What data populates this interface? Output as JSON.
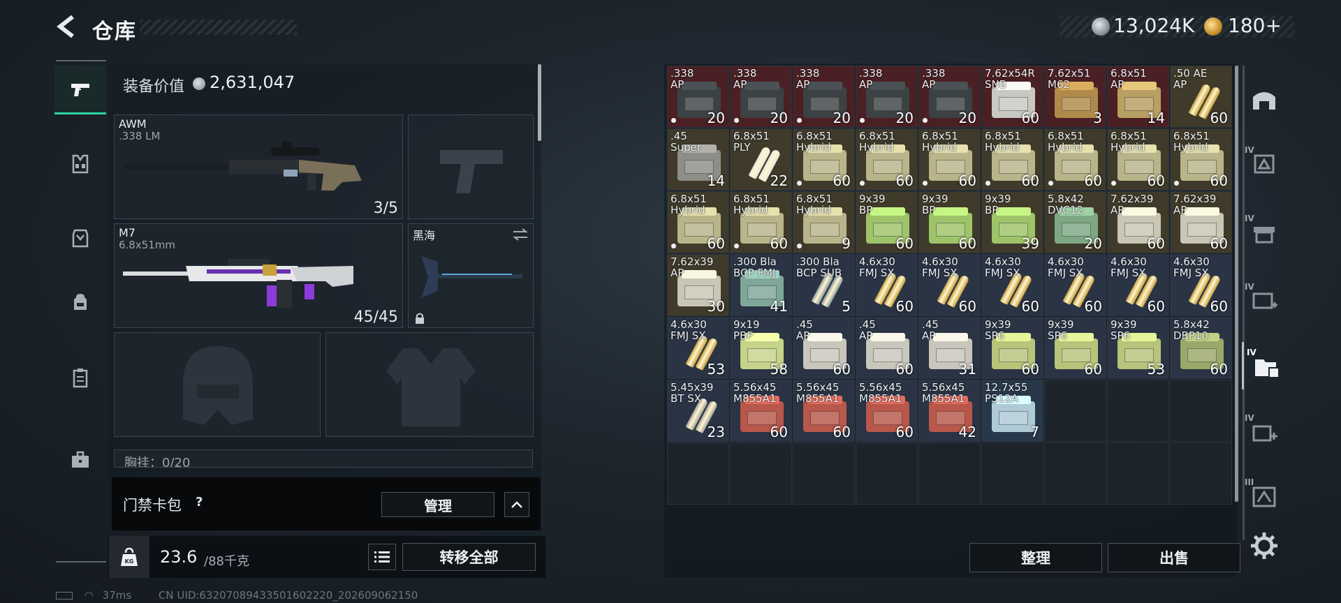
{
  "header": {
    "title": "仓库",
    "currency_silver": "13,024K",
    "currency_gold": "180+"
  },
  "left_nav": {
    "items": [
      {
        "icon": "pistol-icon",
        "active": true
      },
      {
        "icon": "vest-icon"
      },
      {
        "icon": "armor-icon"
      },
      {
        "icon": "backpack-icon"
      },
      {
        "icon": "clipboard-icon"
      },
      {
        "icon": "briefcase-icon"
      }
    ]
  },
  "loadout": {
    "equipment_value_label": "装备价值",
    "equipment_value": "2,631,047",
    "primary": {
      "name": "AWM",
      "caliber": ".338 LM",
      "count": "3/5"
    },
    "secondary": {
      "name": "M7",
      "caliber": "6.8x51mm",
      "count": "45/45"
    },
    "melee": {
      "name": "黑海"
    },
    "chest_label": "胸挂：0/20",
    "keycard_label": "门禁卡包",
    "keycard_help": "?",
    "keycard_manage": "管理",
    "weight_current": "23.6",
    "weight_max": "/88千克",
    "transfer_all": "转移全部"
  },
  "status": {
    "ping": "37ms",
    "uid": "CN UID:63207089433501602220_202609062150"
  },
  "stash": {
    "items": [
      {
        "cal": ".338",
        "type": "AP",
        "qty": "20",
        "dot": true,
        "bg": "#4a2024",
        "box": "#3c4244",
        "kind": "box"
      },
      {
        "cal": ".338",
        "type": "AP",
        "qty": "20",
        "dot": true,
        "bg": "#4a2024",
        "box": "#3c4244",
        "kind": "box"
      },
      {
        "cal": ".338",
        "type": "AP",
        "qty": "20",
        "dot": true,
        "bg": "#4a2024",
        "box": "#3c4244",
        "kind": "box"
      },
      {
        "cal": ".338",
        "type": "AP",
        "qty": "20",
        "dot": true,
        "bg": "#4a2024",
        "box": "#3c4244",
        "kind": "box"
      },
      {
        "cal": ".338",
        "type": "AP",
        "qty": "20",
        "dot": true,
        "bg": "#4a2024",
        "box": "#3c4244",
        "kind": "box"
      },
      {
        "cal": "7.62x54R",
        "type": "SNB",
        "qty": "60",
        "dot": false,
        "bg": "#4a2024",
        "box": "#c9c9c4",
        "kind": "box"
      },
      {
        "cal": "7.62x51",
        "type": "M62",
        "qty": "3",
        "dot": false,
        "bg": "#4a2024",
        "box": "#b08a4a",
        "kind": "box"
      },
      {
        "cal": "6.8x51",
        "type": "AP",
        "qty": "14",
        "dot": false,
        "bg": "#4a2024",
        "box": "#b89f62",
        "kind": "box"
      },
      {
        "cal": ".50 AE",
        "type": "AP",
        "qty": "60",
        "dot": false,
        "bg": "#3f3a2a",
        "box": "#c9a03a",
        "kind": "round"
      },
      {
        "cal": ".45",
        "type": "Super",
        "qty": "14",
        "dot": false,
        "bg": "#3f3a2a",
        "box": "#8e8e88",
        "kind": "box"
      },
      {
        "cal": "6.8x51",
        "type": "PLY",
        "qty": "22",
        "dot": false,
        "bg": "#3f3a2a",
        "box": "#e6e6e2",
        "kind": "round"
      },
      {
        "cal": "6.8x51",
        "type": "Hybrid",
        "qty": "60",
        "dot": true,
        "bg": "#3f3a2a",
        "box": "#b9b48a",
        "kind": "box"
      },
      {
        "cal": "6.8x51",
        "type": "Hybrid",
        "qty": "60",
        "dot": true,
        "bg": "#3f3a2a",
        "box": "#b9b48a",
        "kind": "box"
      },
      {
        "cal": "6.8x51",
        "type": "Hybrid",
        "qty": "60",
        "dot": true,
        "bg": "#3f3a2a",
        "box": "#b9b48a",
        "kind": "box"
      },
      {
        "cal": "6.8x51",
        "type": "Hybrid",
        "qty": "60",
        "dot": true,
        "bg": "#3f3a2a",
        "box": "#b9b48a",
        "kind": "box"
      },
      {
        "cal": "6.8x51",
        "type": "Hybrid",
        "qty": "60",
        "dot": true,
        "bg": "#3f3a2a",
        "box": "#b9b48a",
        "kind": "box"
      },
      {
        "cal": "6.8x51",
        "type": "Hybrid",
        "qty": "60",
        "dot": true,
        "bg": "#3f3a2a",
        "box": "#b9b48a",
        "kind": "box"
      },
      {
        "cal": "6.8x51",
        "type": "Hybrid",
        "qty": "60",
        "dot": true,
        "bg": "#3f3a2a",
        "box": "#b9b48a",
        "kind": "box"
      },
      {
        "cal": "6.8x51",
        "type": "Hybrid",
        "qty": "60",
        "dot": true,
        "bg": "#3f3a2a",
        "box": "#b9b48a",
        "kind": "box"
      },
      {
        "cal": "6.8x51",
        "type": "Hybrid",
        "qty": "60",
        "dot": true,
        "bg": "#3f3a2a",
        "box": "#b9b48a",
        "kind": "box"
      },
      {
        "cal": "6.8x51",
        "type": "Hybrid",
        "qty": "9",
        "dot": true,
        "bg": "#3f3a2a",
        "box": "#b9b48a",
        "kind": "box"
      },
      {
        "cal": "9x39",
        "type": "BP",
        "qty": "60",
        "dot": false,
        "bg": "#3f3a2a",
        "box": "#9ec46a",
        "kind": "box"
      },
      {
        "cal": "9x39",
        "type": "BP",
        "qty": "60",
        "dot": false,
        "bg": "#3f3a2a",
        "box": "#9ec46a",
        "kind": "box"
      },
      {
        "cal": "9x39",
        "type": "BP",
        "qty": "39",
        "dot": false,
        "bg": "#3f3a2a",
        "box": "#9ec46a",
        "kind": "box"
      },
      {
        "cal": "5.8x42",
        "type": "DVC12",
        "qty": "20",
        "dot": false,
        "bg": "#3f3a2a",
        "box": "#7ea884",
        "kind": "box"
      },
      {
        "cal": "7.62x39",
        "type": "AP",
        "qty": "60",
        "dot": false,
        "bg": "#3f3a2a",
        "box": "#c9c6b4",
        "kind": "box"
      },
      {
        "cal": "7.62x39",
        "type": "AP",
        "qty": "60",
        "dot": false,
        "bg": "#3f3a2a",
        "box": "#c9c6b4",
        "kind": "box"
      },
      {
        "cal": "7.62x39",
        "type": "AP",
        "qty": "30",
        "dot": false,
        "bg": "#3f3a2a",
        "box": "#c9c6b4",
        "kind": "box"
      },
      {
        "cal": ".300 Bla",
        "type": "BCP FMJ",
        "qty": "41",
        "dot": false,
        "bg": "#2a3444",
        "box": "#7fa79a",
        "kind": "box"
      },
      {
        "cal": ".300 Bla",
        "type": "BCP SUB",
        "qty": "5",
        "dot": false,
        "bg": "#2a3444",
        "box": "#8a9a9e",
        "kind": "round"
      },
      {
        "cal": "4.6x30",
        "type": "FMJ SX",
        "qty": "60",
        "dot": false,
        "bg": "#2a3444",
        "box": "#c9a03a",
        "kind": "round"
      },
      {
        "cal": "4.6x30",
        "type": "FMJ SX",
        "qty": "60",
        "dot": false,
        "bg": "#2a3444",
        "box": "#c9a03a",
        "kind": "round"
      },
      {
        "cal": "4.6x30",
        "type": "FMJ SX",
        "qty": "60",
        "dot": false,
        "bg": "#2a3444",
        "box": "#c9a03a",
        "kind": "round"
      },
      {
        "cal": "4.6x30",
        "type": "FMJ SX",
        "qty": "60",
        "dot": false,
        "bg": "#2a3444",
        "box": "#c9a03a",
        "kind": "round"
      },
      {
        "cal": "4.6x30",
        "type": "FMJ SX",
        "qty": "60",
        "dot": false,
        "bg": "#2a3444",
        "box": "#c9a03a",
        "kind": "round"
      },
      {
        "cal": "4.6x30",
        "type": "FMJ SX",
        "qty": "60",
        "dot": false,
        "bg": "#2a3444",
        "box": "#c9a03a",
        "kind": "round"
      },
      {
        "cal": "4.6x30",
        "type": "FMJ SX",
        "qty": "53",
        "dot": false,
        "bg": "#2a3444",
        "box": "#c9a03a",
        "kind": "round"
      },
      {
        "cal": "9x19",
        "type": "PBP",
        "qty": "58",
        "dot": false,
        "bg": "#2a3444",
        "box": "#c6d48a",
        "kind": "box"
      },
      {
        "cal": ".45",
        "type": "AP",
        "qty": "60",
        "dot": false,
        "bg": "#2a3444",
        "box": "#c9c6bc",
        "kind": "box"
      },
      {
        "cal": ".45",
        "type": "AP",
        "qty": "60",
        "dot": false,
        "bg": "#2a3444",
        "box": "#c9c6bc",
        "kind": "box"
      },
      {
        "cal": ".45",
        "type": "AP",
        "qty": "31",
        "dot": false,
        "bg": "#2a3444",
        "box": "#c9c6bc",
        "kind": "box"
      },
      {
        "cal": "9x39",
        "type": "SP6",
        "qty": "60",
        "dot": false,
        "bg": "#2a3444",
        "box": "#b8c47a",
        "kind": "box"
      },
      {
        "cal": "9x39",
        "type": "SP6",
        "qty": "60",
        "dot": false,
        "bg": "#2a3444",
        "box": "#b8c47a",
        "kind": "box"
      },
      {
        "cal": "9x39",
        "type": "SP6",
        "qty": "53",
        "dot": false,
        "bg": "#2a3444",
        "box": "#b8c47a",
        "kind": "box"
      },
      {
        "cal": "5.8x42",
        "type": "DBP10",
        "qty": "60",
        "dot": false,
        "bg": "#2a3444",
        "box": "#9aa86a",
        "kind": "box"
      },
      {
        "cal": "5.45x39",
        "type": "BT SX",
        "qty": "23",
        "dot": false,
        "bg": "#2a3444",
        "box": "#a8a49a",
        "kind": "round"
      },
      {
        "cal": "5.56x45",
        "type": "M855A1",
        "qty": "60",
        "dot": false,
        "bg": "#2a3444",
        "box": "#b8574a",
        "kind": "box"
      },
      {
        "cal": "5.56x45",
        "type": "M855A1",
        "qty": "60",
        "dot": false,
        "bg": "#2a3444",
        "box": "#b8574a",
        "kind": "box"
      },
      {
        "cal": "5.56x45",
        "type": "M855A1",
        "qty": "60",
        "dot": false,
        "bg": "#2a3444",
        "box": "#b8574a",
        "kind": "box"
      },
      {
        "cal": "5.56x45",
        "type": "M855A1",
        "qty": "42",
        "dot": false,
        "bg": "#2a3444",
        "box": "#b8574a",
        "kind": "box"
      },
      {
        "cal": "12.7x55",
        "type": "PS12A",
        "qty": "7",
        "dot": false,
        "bg": "#26384a",
        "box": "#aecad6",
        "kind": "box"
      }
    ],
    "sort_label": "整理",
    "sell_label": "出售"
  },
  "right_nav": {
    "items": [
      {
        "icon": "bunker-icon",
        "level": ""
      },
      {
        "icon": "blueprint-icon",
        "level": "IV"
      },
      {
        "icon": "rifle-crate-icon",
        "level": "IV"
      },
      {
        "icon": "medical-crate-icon",
        "level": "IV"
      },
      {
        "icon": "storage-folder-icon",
        "level": "IV",
        "active": true
      },
      {
        "icon": "med-kit-icon",
        "level": "IV"
      },
      {
        "icon": "crate-icon",
        "level": "III"
      }
    ]
  }
}
